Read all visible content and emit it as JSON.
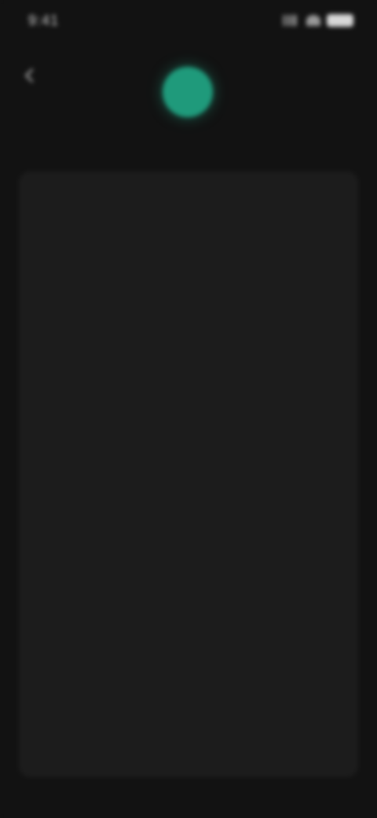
{
  "status_bar": {
    "time": "9:41",
    "icons": [
      "signal-icon",
      "wifi-icon",
      "battery-icon"
    ]
  },
  "header": {
    "back_icon": "back-arrow-icon",
    "avatar_initial": "",
    "profile_name": "",
    "accent_color": "#1f9a7b"
  },
  "settings": {
    "items": [
      {
        "title": "",
        "description": ""
      },
      {
        "title": "",
        "description": ""
      },
      {
        "title": "",
        "description": ""
      },
      {
        "title": "",
        "description": ""
      },
      {
        "title": "",
        "description": ""
      },
      {
        "title": "",
        "description": ""
      },
      {
        "title": "",
        "description": ""
      },
      {
        "title": "",
        "description": ""
      }
    ]
  }
}
